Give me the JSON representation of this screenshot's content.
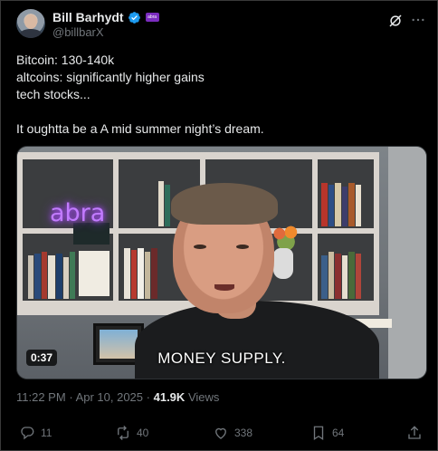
{
  "author": {
    "name": "Bill Barhydt",
    "handle": "@billbarX",
    "affiliate_badge": "abra",
    "verified": true
  },
  "tweet": {
    "lines": [
      "Bitcoin: 130-140k",
      "altcoins: significantly higher gains",
      "tech stocks...",
      "",
      "It oughtta be a A mid summer night’s dream."
    ]
  },
  "video": {
    "caption": "MONEY SUPPLY.",
    "duration": "0:37",
    "neon_sign": "abra"
  },
  "meta": {
    "time": "11:22 PM",
    "separator": "·",
    "date": "Apr 10, 2025",
    "views_count": "41.9K",
    "views_label": "Views"
  },
  "actions": {
    "replies": "11",
    "reposts": "40",
    "likes": "338",
    "bookmarks": "64"
  },
  "colors": {
    "background": "#000000",
    "text_primary": "#e7e9ea",
    "text_secondary": "#71767b",
    "verified": "#1d9bf0",
    "affiliate": "#7b2cbf"
  },
  "icons": [
    "avatar",
    "verified-badge-icon",
    "grok-icon",
    "more-icon",
    "reply-icon",
    "repost-icon",
    "like-icon",
    "bookmark-icon",
    "share-icon"
  ]
}
